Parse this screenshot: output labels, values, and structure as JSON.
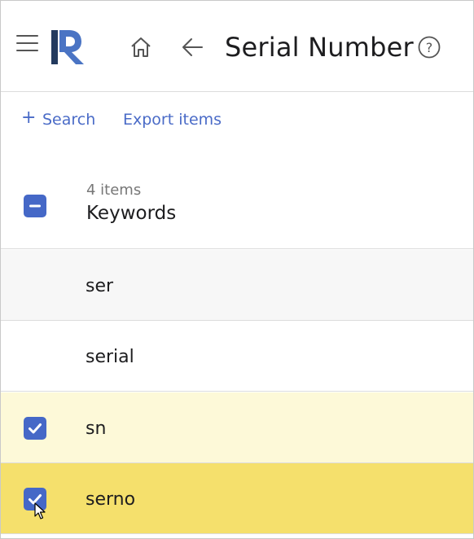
{
  "header": {
    "title": "Serial Number",
    "icons": {
      "menu": "hamburger-icon",
      "logo": "app-logo",
      "home": "home-icon",
      "back": "arrow-left-icon",
      "help": "help-circle-icon"
    }
  },
  "actions": {
    "search_label": "Search",
    "export_label": "Export items",
    "plus_glyph": "+"
  },
  "list": {
    "count_label": "4 items",
    "column_label": "Keywords",
    "select_all_state": "indeterminate",
    "rows": [
      {
        "label": "ser",
        "checked": false,
        "state": "hover"
      },
      {
        "label": "serial",
        "checked": false,
        "state": "normal"
      },
      {
        "label": "sn",
        "checked": true,
        "state": "selected"
      },
      {
        "label": "serno",
        "checked": true,
        "state": "selected-focused"
      }
    ]
  },
  "colors": {
    "accent": "#4568c7",
    "link": "#4a6bc7",
    "selected_row": "#fdf9d8",
    "active_row": "#f5e06c",
    "hover_row": "#f7f7f7"
  }
}
